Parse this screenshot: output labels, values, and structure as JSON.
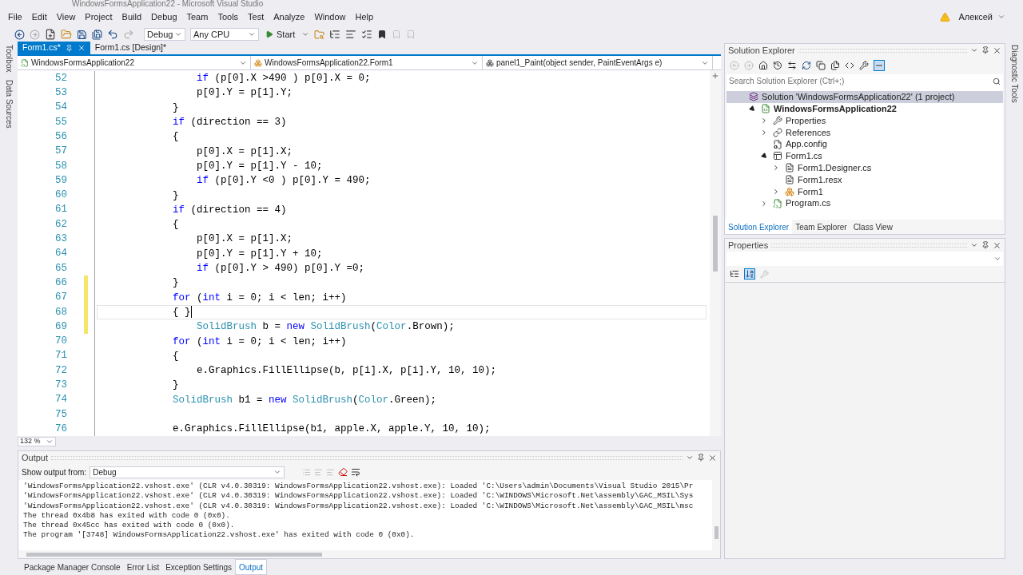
{
  "window": {
    "title": "WindowsFormsApplication22 - Microsoft Visual Studio",
    "user": "Алексей"
  },
  "menu": [
    "File",
    "Edit",
    "View",
    "Project",
    "Build",
    "Debug",
    "Team",
    "Tools",
    "Test",
    "Analyze",
    "Window",
    "Help"
  ],
  "toolbar": {
    "configuration": "Debug",
    "platform": "Any CPU",
    "start": "Start"
  },
  "side_left": [
    "Toolbox",
    "Data Sources"
  ],
  "side_right": [
    "Diagnostic Tools"
  ],
  "editor": {
    "tabs": [
      {
        "label": "Form1.cs*",
        "selected": true
      },
      {
        "label": "Form1.cs [Design]*",
        "selected": false
      }
    ],
    "nav": [
      "WindowsFormsApplication22",
      "WindowsFormsApplication22.Form1",
      "panel1_Paint(object sender, PaintEventArgs e)"
    ],
    "zoom": "132 %",
    "lines": [
      {
        "number": "52",
        "changed": false,
        "current": false,
        "tokens": [
          {
            "kind": "keyword",
            "text": "                if"
          },
          {
            "kind": "plain",
            "text": " (p[0].X >490 ) p[0].X = 0;"
          }
        ]
      },
      {
        "number": "53",
        "changed": false,
        "current": false,
        "tokens": [
          {
            "kind": "plain",
            "text": "                p[0].Y = p[1].Y;"
          }
        ]
      },
      {
        "number": "54",
        "changed": false,
        "current": false,
        "tokens": [
          {
            "kind": "plain",
            "text": "            }"
          }
        ]
      },
      {
        "number": "55",
        "changed": false,
        "current": false,
        "tokens": [
          {
            "kind": "keyword",
            "text": "            if"
          },
          {
            "kind": "plain",
            "text": " (direction == 3)"
          }
        ]
      },
      {
        "number": "56",
        "changed": false,
        "current": false,
        "tokens": [
          {
            "kind": "plain",
            "text": "            {"
          }
        ]
      },
      {
        "number": "57",
        "changed": false,
        "current": false,
        "tokens": [
          {
            "kind": "plain",
            "text": "                p[0].X = p[1].X;"
          }
        ]
      },
      {
        "number": "58",
        "changed": false,
        "current": false,
        "tokens": [
          {
            "kind": "plain",
            "text": "                p[0].Y = p[1].Y - 10;"
          }
        ]
      },
      {
        "number": "59",
        "changed": false,
        "current": false,
        "tokens": [
          {
            "kind": "keyword",
            "text": "                if"
          },
          {
            "kind": "plain",
            "text": " (p[0].Y <0 ) p[0].Y = 490;"
          }
        ]
      },
      {
        "number": "60",
        "changed": false,
        "current": false,
        "tokens": [
          {
            "kind": "plain",
            "text": "            }"
          }
        ]
      },
      {
        "number": "61",
        "changed": false,
        "current": false,
        "tokens": [
          {
            "kind": "keyword",
            "text": "            if"
          },
          {
            "kind": "plain",
            "text": " (direction == 4)"
          }
        ]
      },
      {
        "number": "62",
        "changed": false,
        "current": false,
        "tokens": [
          {
            "kind": "plain",
            "text": "            {"
          }
        ]
      },
      {
        "number": "63",
        "changed": false,
        "current": false,
        "tokens": [
          {
            "kind": "plain",
            "text": "                p[0].X = p[1].X;"
          }
        ]
      },
      {
        "number": "64",
        "changed": false,
        "current": false,
        "tokens": [
          {
            "kind": "plain",
            "text": "                p[0].Y = p[1].Y + 10;"
          }
        ]
      },
      {
        "number": "65",
        "changed": false,
        "current": false,
        "tokens": [
          {
            "kind": "keyword",
            "text": "                if"
          },
          {
            "kind": "plain",
            "text": " (p[0].Y > 490) p[0].Y =0;"
          }
        ]
      },
      {
        "number": "66",
        "changed": true,
        "current": false,
        "tokens": [
          {
            "kind": "plain",
            "text": "            }"
          }
        ]
      },
      {
        "number": "67",
        "changed": true,
        "current": false,
        "tokens": [
          {
            "kind": "keyword",
            "text": "            for"
          },
          {
            "kind": "plain",
            "text": " ("
          },
          {
            "kind": "keyword",
            "text": "int"
          },
          {
            "kind": "plain",
            "text": " i = 0; i < len; i++)"
          }
        ]
      },
      {
        "number": "68",
        "changed": true,
        "current": true,
        "tokens": [
          {
            "kind": "plain",
            "text": "            { }"
          }
        ]
      },
      {
        "number": "69",
        "changed": true,
        "current": false,
        "tokens": [
          {
            "kind": "type",
            "text": "                SolidBrush"
          },
          {
            "kind": "plain",
            "text": " b = "
          },
          {
            "kind": "keyword",
            "text": "new "
          },
          {
            "kind": "type",
            "text": "SolidBrush"
          },
          {
            "kind": "plain",
            "text": "("
          },
          {
            "kind": "type",
            "text": "Color"
          },
          {
            "kind": "plain",
            "text": ".Brown);"
          }
        ]
      },
      {
        "number": "70",
        "changed": false,
        "current": false,
        "tokens": [
          {
            "kind": "keyword",
            "text": "            for"
          },
          {
            "kind": "plain",
            "text": " ("
          },
          {
            "kind": "keyword",
            "text": "int"
          },
          {
            "kind": "plain",
            "text": " i = 0; i < len; i++)"
          }
        ]
      },
      {
        "number": "71",
        "changed": false,
        "current": false,
        "tokens": [
          {
            "kind": "plain",
            "text": "            {"
          }
        ]
      },
      {
        "number": "72",
        "changed": false,
        "current": false,
        "tokens": [
          {
            "kind": "plain",
            "text": "                e.Graphics.FillEllipse(b, p[i].X, p[i].Y, 10, 10);"
          }
        ]
      },
      {
        "number": "73",
        "changed": false,
        "current": false,
        "tokens": [
          {
            "kind": "plain",
            "text": "            }"
          }
        ]
      },
      {
        "number": "74",
        "changed": false,
        "current": false,
        "tokens": [
          {
            "kind": "type",
            "text": "            SolidBrush"
          },
          {
            "kind": "plain",
            "text": " b1 = "
          },
          {
            "kind": "keyword",
            "text": "new "
          },
          {
            "kind": "type",
            "text": "SolidBrush"
          },
          {
            "kind": "plain",
            "text": "("
          },
          {
            "kind": "type",
            "text": "Color"
          },
          {
            "kind": "plain",
            "text": ".Green);"
          }
        ]
      },
      {
        "number": "75",
        "changed": false,
        "current": false
      },
      {
        "number": "76",
        "changed": false,
        "current": false,
        "tokens": [
          {
            "kind": "plain",
            "text": "            e.Graphics.FillEllipse(b1, apple.X, apple.Y, 10, 10);"
          }
        ]
      }
    ]
  },
  "output": {
    "title": "Output",
    "source_label": "Show output from:",
    "source": "Debug",
    "lines": [
      "'WindowsFormsApplication22.vshost.exe' (CLR v4.0.30319: WindowsFormsApplication22.vshost.exe): Loaded 'C:\\Users\\admin\\Documents\\Visual Studio 2015\\Pr",
      "'WindowsFormsApplication22.vshost.exe' (CLR v4.0.30319: WindowsFormsApplication22.vshost.exe): Loaded 'C:\\WINDOWS\\Microsoft.Net\\assembly\\GAC_MSIL\\Sys",
      "'WindowsFormsApplication22.vshost.exe' (CLR v4.0.30319: WindowsFormsApplication22.vshost.exe): Loaded 'C:\\WINDOWS\\Microsoft.Net\\assembly\\GAC_MSIL\\msc",
      "The thread 0x4b8 has exited with code 0 (0x0).",
      "The thread 0x45cc has exited with code 0 (0x0).",
      "The program '[3748] WindowsFormsApplication22.vshost.exe' has exited with code 0 (0x0)."
    ]
  },
  "bottom_tabs": [
    {
      "label": "Package Manager Console",
      "selected": false
    },
    {
      "label": "Error List",
      "selected": false
    },
    {
      "label": "Exception Settings",
      "selected": false
    },
    {
      "label": "Output",
      "selected": true
    }
  ],
  "solution_explorer": {
    "title": "Solution Explorer",
    "search_placeholder": "Search Solution Explorer (Ctrl+;)",
    "tree": [
      {
        "label": "Solution 'WindowsFormsApplication22' (1 project)",
        "kind": "solution",
        "selected": true,
        "children": [
          {
            "label": "WindowsFormsApplication22",
            "kind": "project",
            "selected": false,
            "expanded": true,
            "children": [
              {
                "label": "Properties",
                "kind": "properties",
                "selected": false,
                "expanded": false
              },
              {
                "label": "References",
                "kind": "references",
                "selected": false,
                "expanded": false
              },
              {
                "label": "App.config",
                "kind": "config",
                "selected": false
              },
              {
                "label": "Form1.cs",
                "kind": "form",
                "selected": false,
                "expanded": true,
                "children": [
                  {
                    "label": "Form1.Designer.cs",
                    "kind": "file",
                    "selected": false,
                    "expanded": false
                  },
                  {
                    "label": "Form1.resx",
                    "kind": "file",
                    "selected": false
                  },
                  {
                    "label": "Form1",
                    "kind": "class",
                    "selected": false,
                    "expanded": false
                  }
                ]
              },
              {
                "label": "Program.cs",
                "kind": "csharp",
                "selected": false,
                "expanded": false
              }
            ]
          }
        ]
      }
    ],
    "tabs": [
      {
        "label": "Solution Explorer",
        "selected": true
      },
      {
        "label": "Team Explorer",
        "selected": false
      },
      {
        "label": "Class View",
        "selected": false
      }
    ]
  },
  "properties": {
    "title": "Properties"
  }
}
